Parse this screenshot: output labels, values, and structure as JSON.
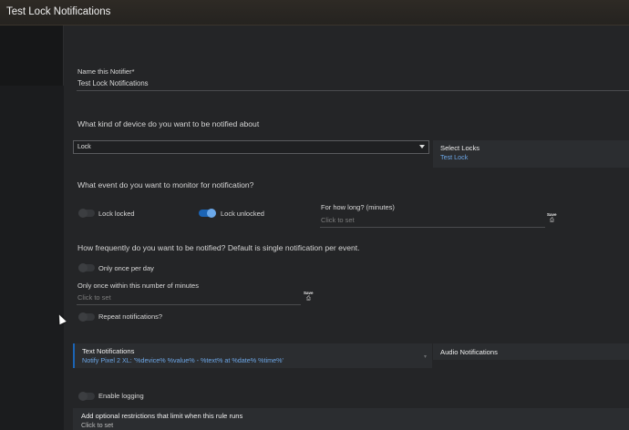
{
  "window": {
    "title": "Test Lock Notifications"
  },
  "name_field": {
    "label": "Name this Notifier*",
    "value": "Test Lock Notifications"
  },
  "device_question": "What kind of device do you want to be notified about",
  "device_select": {
    "value": "Lock"
  },
  "select_locks": {
    "title": "Select Locks",
    "value": "Test Lock"
  },
  "event_question": "What event do you want to monitor for notification?",
  "events": {
    "lock_locked": {
      "label": "Lock locked",
      "on": false
    },
    "lock_unlocked": {
      "label": "Lock unlocked",
      "on": true
    }
  },
  "duration": {
    "label": "For how long? (minutes)",
    "placeholder": "Click to set",
    "save_label": "Save"
  },
  "frequency_question": "How frequently do you want to be notified?  Default is single notification per event.",
  "once_per_day": {
    "label": "Only once per day",
    "on": false
  },
  "minutes_limit": {
    "label": "Only once within this number of minutes",
    "placeholder": "Click to set",
    "save_label": "Save"
  },
  "repeat": {
    "label": "Repeat notifications?",
    "on": false
  },
  "text_notifications": {
    "title": "Text Notifications",
    "value": "Notify Pixel 2 XL: '%device% %value% - %text% at %date% %time%'"
  },
  "audio_notifications": {
    "title": "Audio Notifications"
  },
  "logging": {
    "label": "Enable logging",
    "on": false
  },
  "restrictions": {
    "title": "Add optional restrictions that limit when this rule runs",
    "placeholder": "Click to set"
  },
  "icons": {
    "select_caret": "caret-down-icon",
    "save": "save-icon",
    "chevron": "chevron-down-icon",
    "cursor": "mouse-cursor-icon"
  },
  "colors": {
    "accent": "#1b64b5",
    "link": "#6ca6e6",
    "background": "#242527"
  }
}
